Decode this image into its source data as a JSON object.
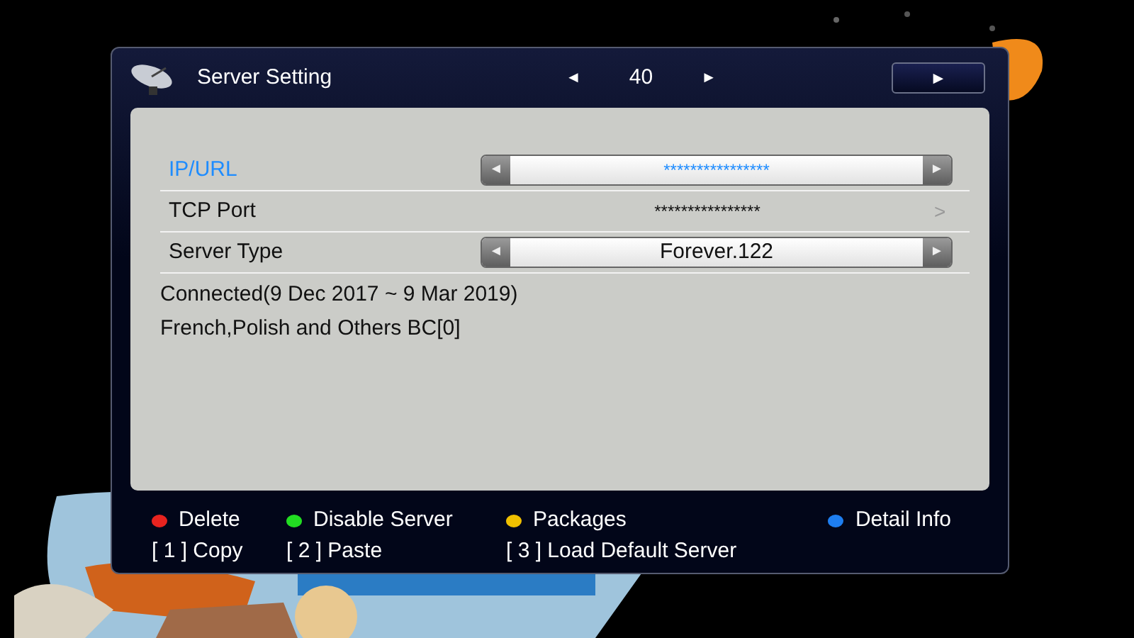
{
  "window": {
    "title": "Server Setting",
    "prev": "◄",
    "page": "40",
    "next": "►",
    "top_button": "►"
  },
  "fields": [
    {
      "kind": "spinner",
      "label": "IP/URL",
      "value": "****************",
      "left": "◄",
      "right": "►",
      "selected": true
    },
    {
      "kind": "link",
      "label": "TCP Port",
      "value": "****************",
      "chevron": ">",
      "selected": false
    },
    {
      "kind": "spinner",
      "label": "Server Type",
      "value": "Forever.122",
      "left": "◄",
      "right": "►",
      "selected": false
    }
  ],
  "status_lines": [
    "Connected(9 Dec 2017 ~ 9 Mar 2019)",
    "French,Polish and Others BC[0]"
  ],
  "color_keys": [
    {
      "label": "Delete",
      "color": "#e8231f"
    },
    {
      "label": "Disable Server",
      "color": "#22dd22"
    },
    {
      "label": "Packages",
      "color": "#f0c000"
    },
    {
      "label": "Detail Info",
      "color": "#1e7ef0"
    }
  ],
  "number_keys": [
    "[ 1 ] Copy",
    "[ 2 ] Paste",
    "[ 3 ] Load Default Server"
  ]
}
